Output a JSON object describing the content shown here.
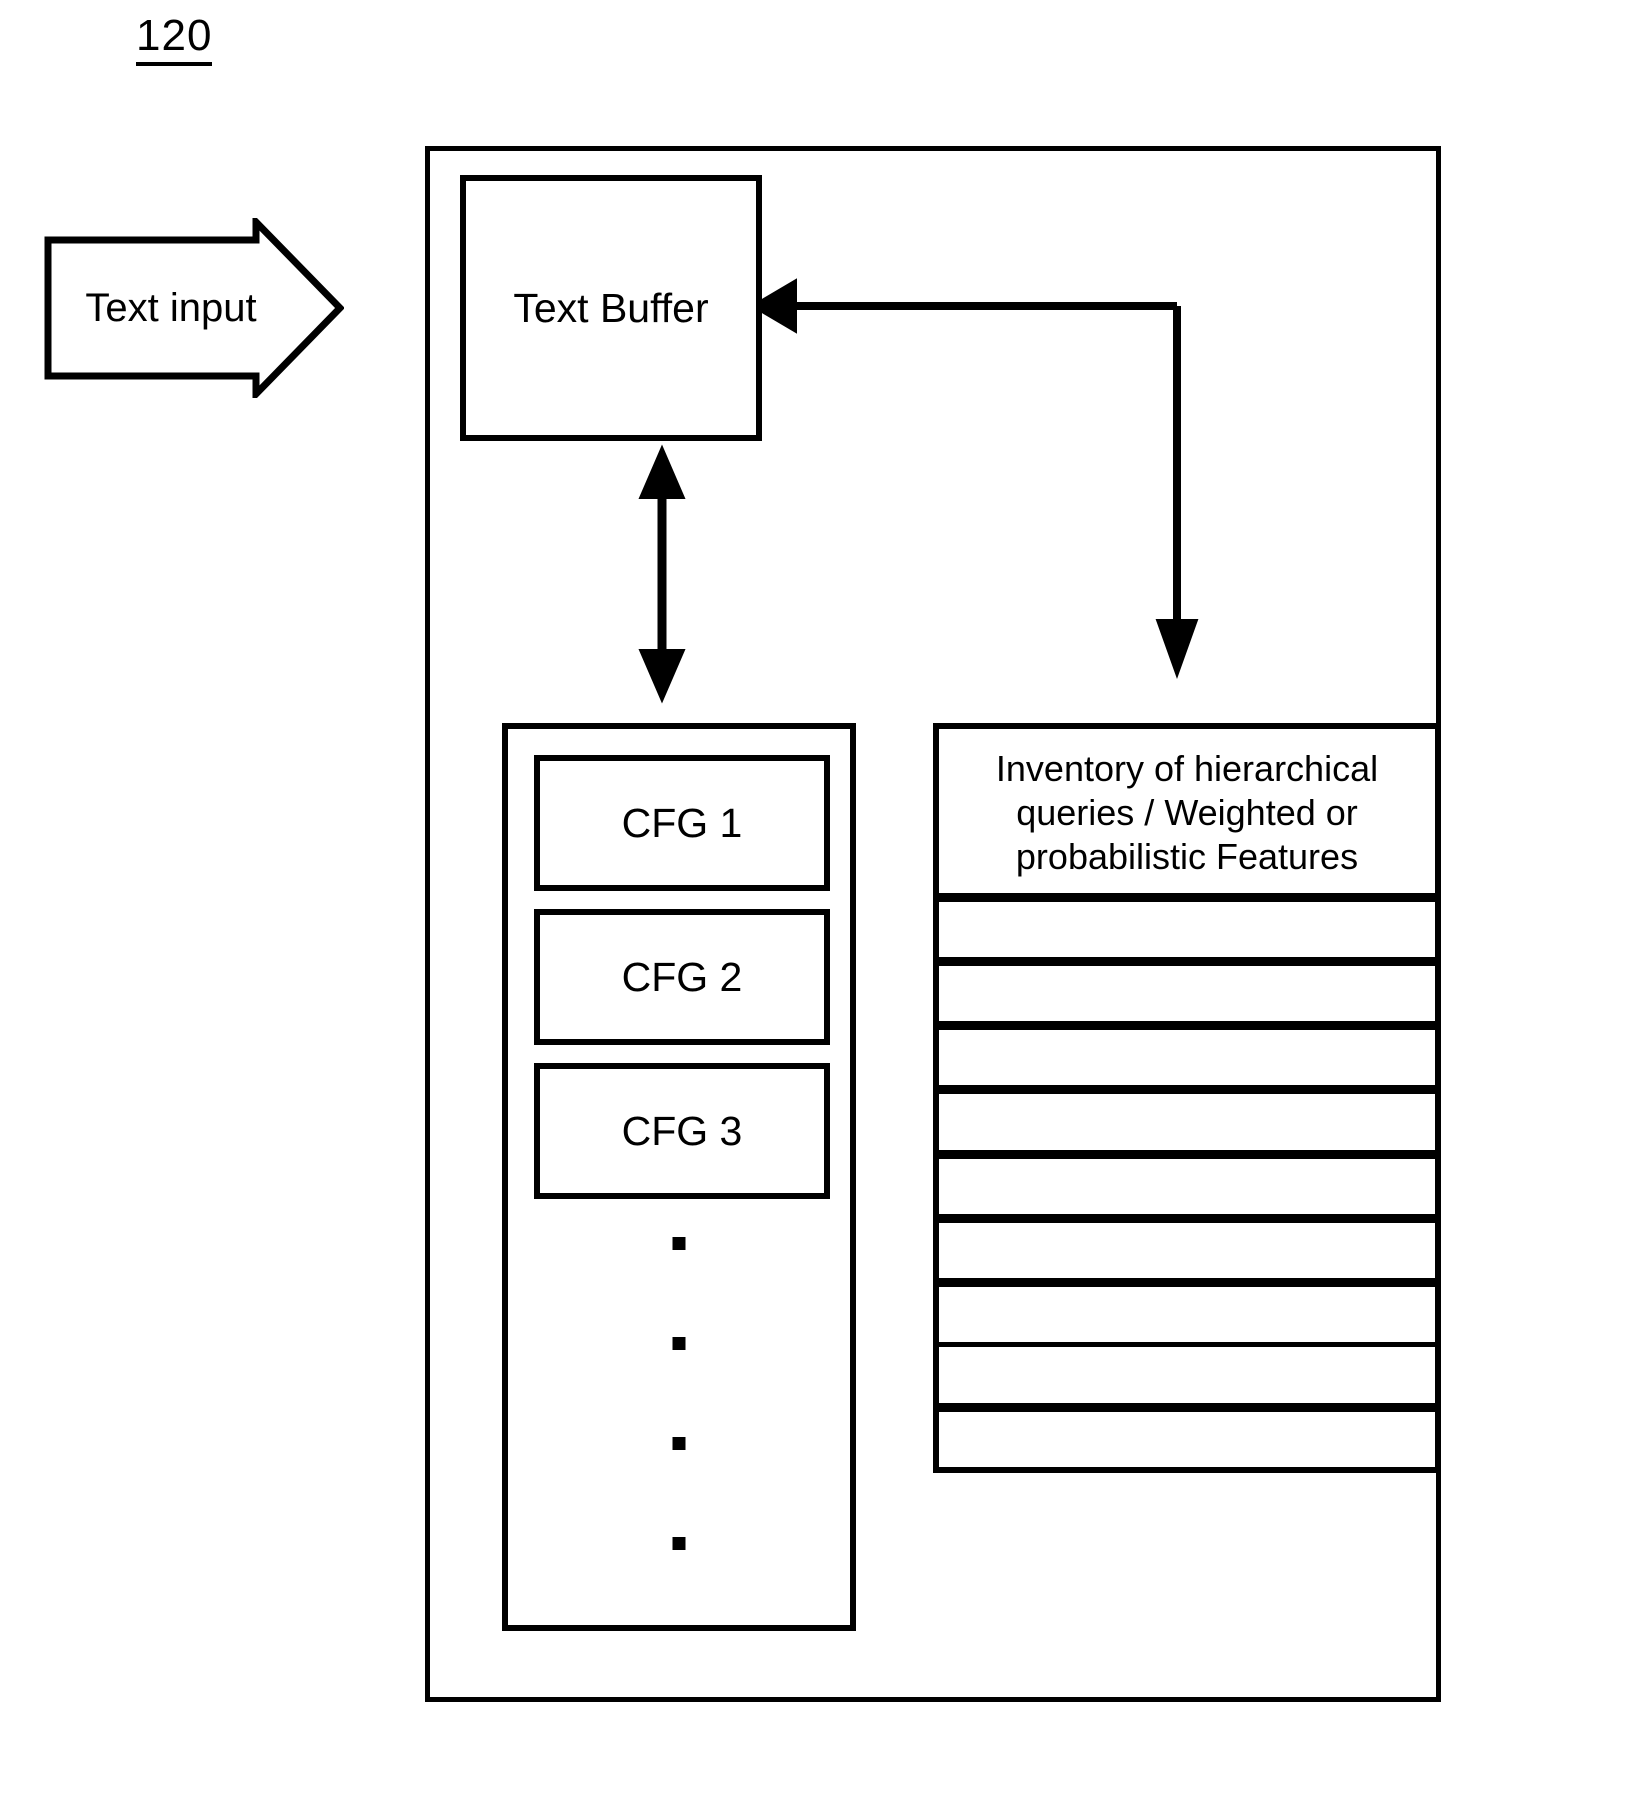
{
  "figure": {
    "reference_numeral": "120"
  },
  "input_arrow": {
    "label": "Text input",
    "direction": "right"
  },
  "text_buffer": {
    "label": "Text Buffer"
  },
  "cfg_stack": {
    "items": [
      {
        "label": "CFG 1"
      },
      {
        "label": "CFG 2"
      },
      {
        "label": "CFG 3"
      }
    ],
    "continuation_dots": 4
  },
  "inventory": {
    "header": "Inventory of hierarchical queries / Weighted or probabilistic Features",
    "rows": [
      "",
      "",
      "",
      "",
      "",
      "",
      "",
      "",
      ""
    ]
  },
  "connections": [
    {
      "name": "inventory-to-text-buffer",
      "from": "inventory",
      "to": "text_buffer",
      "arrowheads": "single"
    },
    {
      "name": "text-buffer-to-cfg-stack",
      "from": "text_buffer",
      "to": "cfg_stack",
      "arrowheads": "double"
    },
    {
      "name": "feedback-to-inventory",
      "from": "text_buffer",
      "to": "inventory",
      "arrowheads": "single"
    }
  ],
  "colors": {
    "ink": "#000000",
    "paper": "#ffffff"
  }
}
